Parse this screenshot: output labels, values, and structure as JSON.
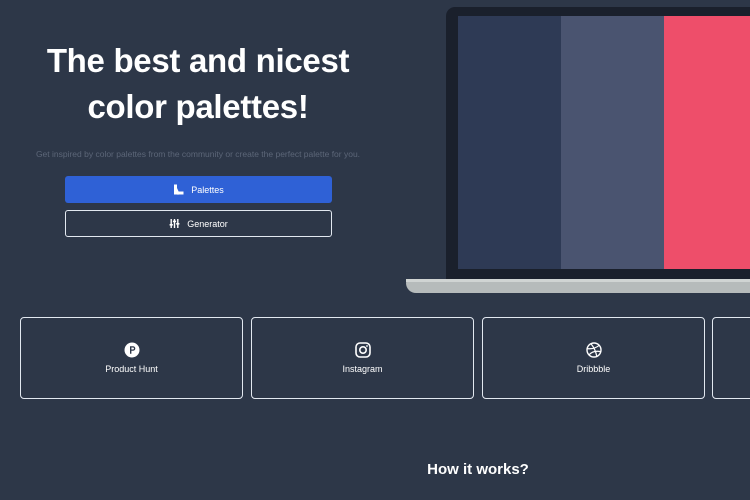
{
  "hero": {
    "title_line1": "The best and nicest",
    "title_line2": "color palettes!",
    "subtitle": "Get inspired by color palettes from the community or create the perfect palette for you."
  },
  "buttons": {
    "palettes_label": "Palettes",
    "palettes_icon": "palettes-icon",
    "generator_label": "Generator",
    "generator_icon": "sliders-icon",
    "palettes_color": "#2f61d6"
  },
  "laptop_preview": {
    "swatches": [
      "#2e3a55",
      "#4a5470",
      "#ee4e6a"
    ]
  },
  "links": [
    {
      "label": "Product Hunt",
      "icon": "product-hunt-icon"
    },
    {
      "label": "Instagram",
      "icon": "instagram-icon"
    },
    {
      "label": "Dribbble",
      "icon": "dribbble-icon"
    }
  ],
  "how_it_works": {
    "title": "How it works?"
  },
  "theme": {
    "background": "#2d3748",
    "accent": "#2f61d6",
    "muted_text": "#5c6678"
  }
}
